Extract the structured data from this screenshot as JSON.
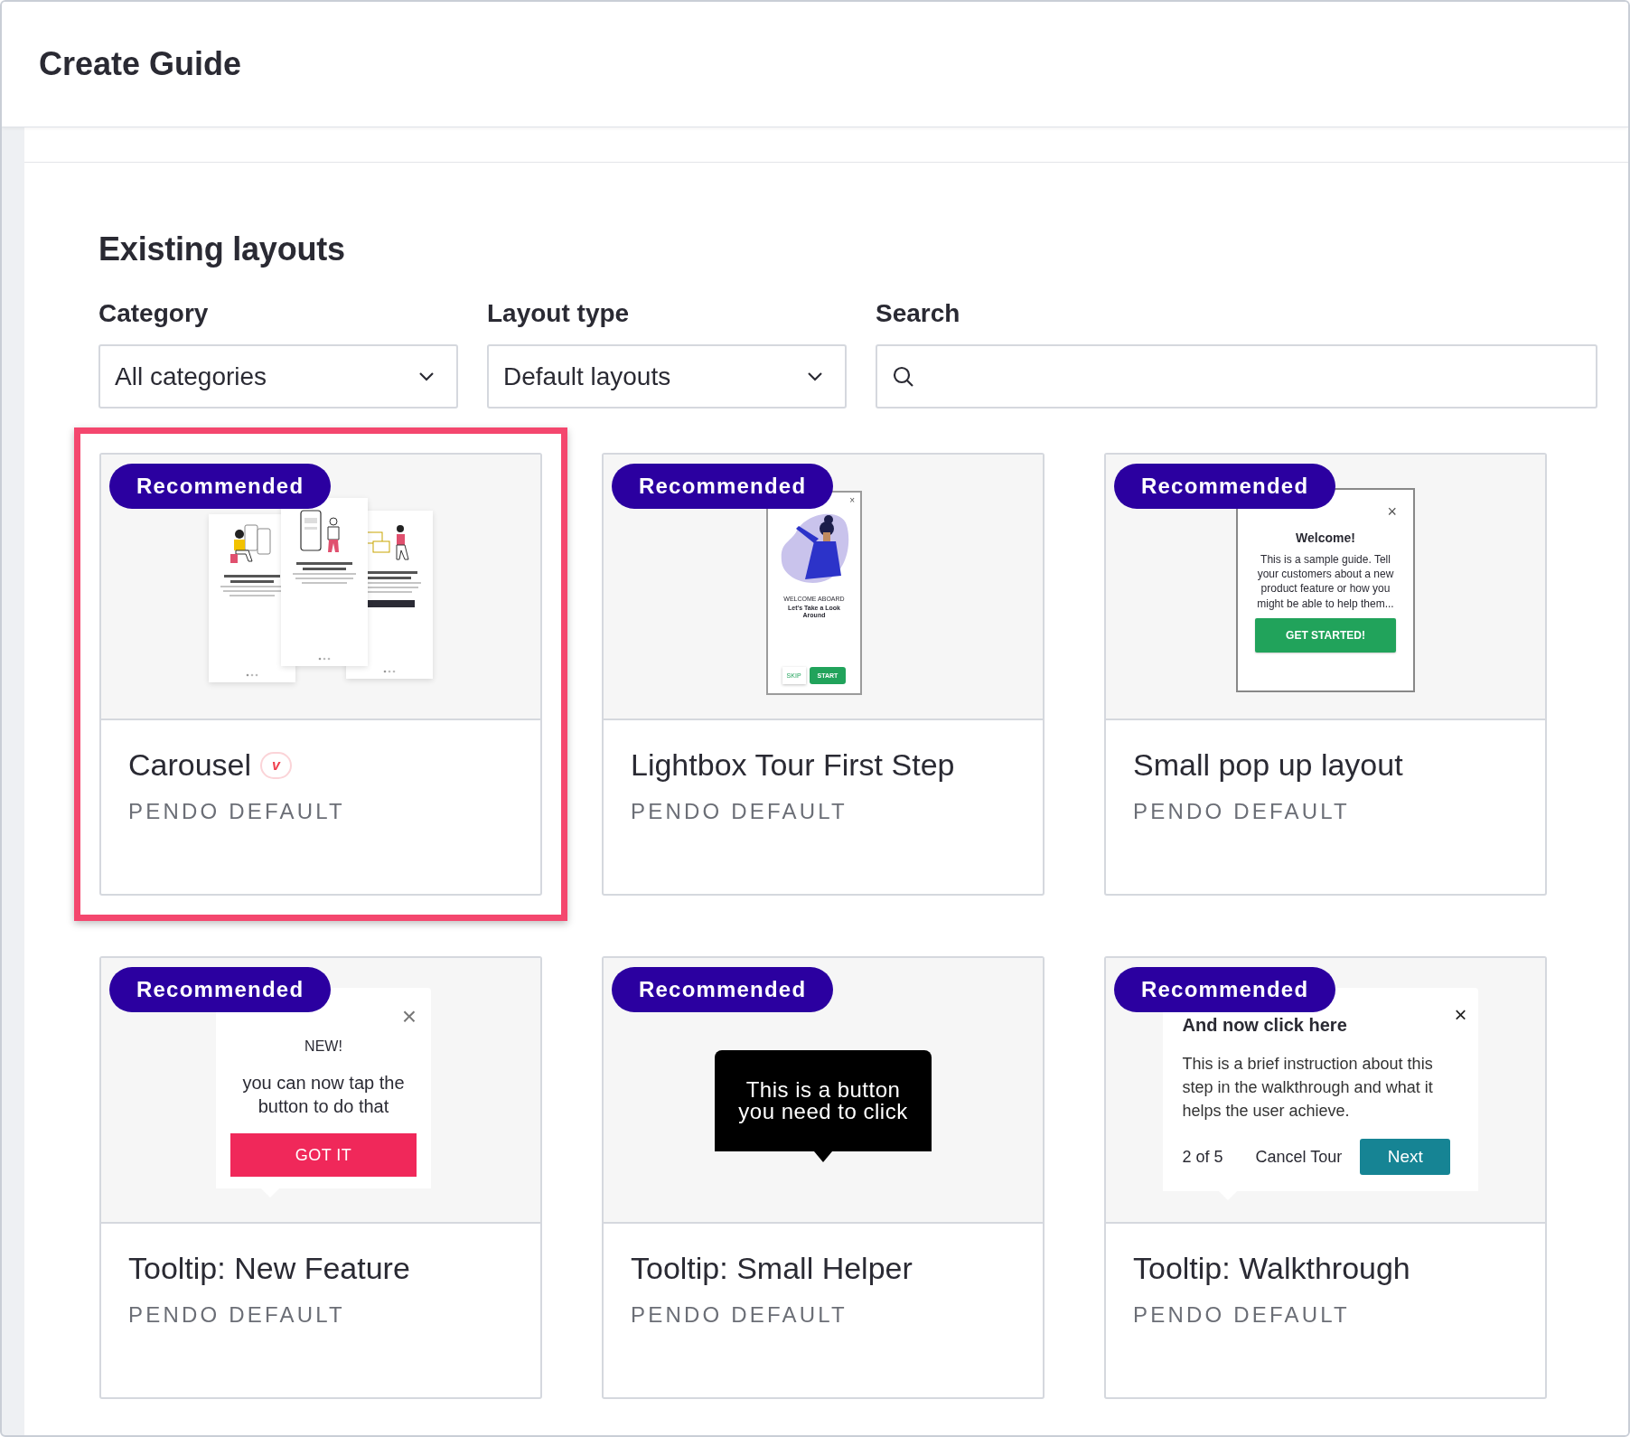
{
  "header": {
    "title": "Create Guide"
  },
  "section": {
    "title": "Existing layouts"
  },
  "filters": [
    {
      "kind": "dropdown",
      "label": "Category",
      "value": "All categories"
    },
    {
      "kind": "dropdown",
      "label": "Layout type",
      "value": "Default layouts"
    },
    {
      "kind": "search",
      "label": "Search"
    }
  ],
  "cards": [
    {
      "badge": "Recommended",
      "title": "Carousel",
      "tag": "v",
      "subtitle": "PENDO DEFAULT",
      "selected": true,
      "preview": {
        "kind": "carousel"
      }
    },
    {
      "badge": "Recommended",
      "title": "Lightbox Tour First Step",
      "subtitle": "PENDO DEFAULT",
      "selected": false,
      "preview": {
        "kind": "lightbox",
        "close": "×",
        "eyebrow": "WELCOME ABOARD",
        "heading": "Let's Take a Look Around",
        "buttons": [
          "SKIP",
          "START"
        ]
      }
    },
    {
      "badge": "Recommended",
      "title": "Small pop up layout",
      "subtitle": "PENDO DEFAULT",
      "selected": false,
      "preview": {
        "kind": "popup",
        "close": "×",
        "heading": "Welcome!",
        "body": "This is a sample guide. Tell your customers about a new product feature or how you might be able to help them...",
        "button": "GET STARTED!"
      }
    },
    {
      "badge": "Recommended",
      "title": "Tooltip: New Feature",
      "subtitle": "PENDO DEFAULT",
      "selected": false,
      "preview": {
        "kind": "tooltip_new",
        "close": "×",
        "eyebrow": "NEW!",
        "body": "you can now tap the button to do that",
        "button": "GOT IT"
      }
    },
    {
      "badge": "Recommended",
      "title": "Tooltip: Small Helper",
      "subtitle": "PENDO DEFAULT",
      "selected": false,
      "preview": {
        "kind": "tooltip_dark",
        "body": "This is a button you need to click"
      }
    },
    {
      "badge": "Recommended",
      "title": "Tooltip: Walkthrough",
      "subtitle": "PENDO DEFAULT",
      "selected": false,
      "preview": {
        "kind": "tooltip_walk",
        "close": "×",
        "heading": "And now click here",
        "body": "This is a brief instruction about this step in the walkthrough and what it helps the user achieve.",
        "step": "2 of 5",
        "cancel": "Cancel Tour",
        "button": "Next"
      }
    }
  ]
}
